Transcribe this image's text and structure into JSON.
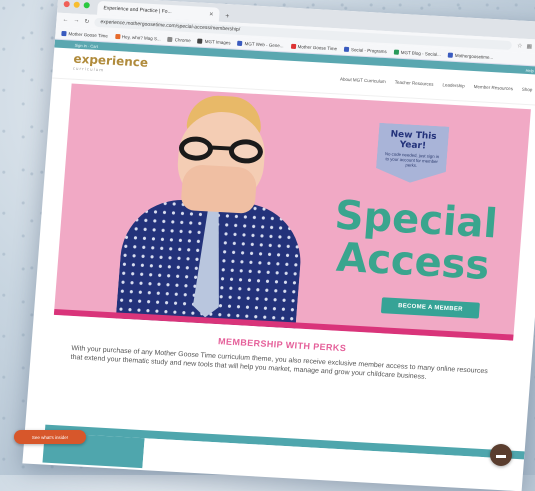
{
  "browser": {
    "tab_title": "Experience and Practice | Fo...",
    "url": "experience.mothergoosetime.com/special-access/membership/",
    "bookmarks": [
      "Mother Goose Time",
      "Hey, who? Mag S...",
      "Chrome",
      "MGT Images",
      "MGT Web - Gene...",
      "Mother Goose Time",
      "Social - Programs",
      "MGT Blog - Social...",
      "Mothergoosetime..."
    ]
  },
  "site": {
    "top_left": "Sign in · Cart",
    "top_right": "Help",
    "logo_text": "experience",
    "logo_sub": "curriculum",
    "nav": [
      "About MGT Curriculum",
      "Teacher Resources",
      "Leadership",
      "Member Resources",
      "Shop"
    ]
  },
  "hero": {
    "badge_title": "New This Year!",
    "badge_text": "No code needed, just sign in to your account for member perks.",
    "headline_line1": "Special",
    "headline_line2": "Access",
    "cta_label": "BECOME A MEMBER"
  },
  "section": {
    "title": "MEMBERSHIP WITH PERKS",
    "text": "With your purchase of any Mother Goose Time curriculum theme, you also receive exclusive member access to many online resources that extend your thematic study and new tools that will help you market, manage and grow your childcare business."
  },
  "floating": {
    "left_pill": "See what's inside!",
    "chat_icon": "chat-bubble-icon"
  },
  "colors": {
    "hero_bg": "#f1a9c5",
    "accent_teal": "#36a396",
    "accent_pink": "#d9347a",
    "headline": "#3aa58e"
  }
}
